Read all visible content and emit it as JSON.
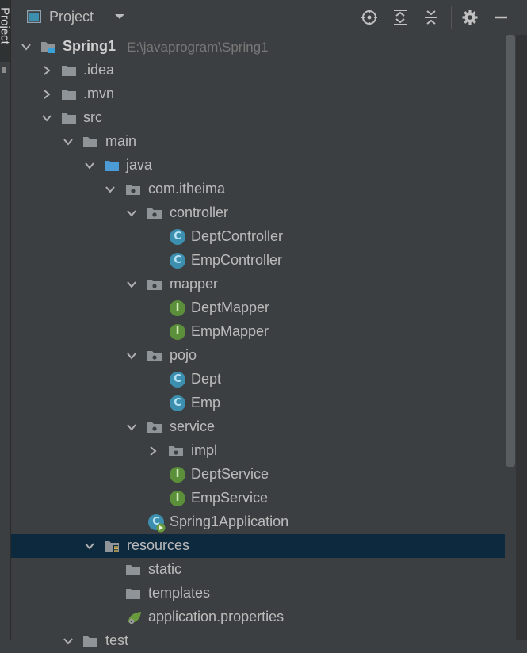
{
  "stripe": {
    "label": "Project"
  },
  "header": {
    "title": "Project",
    "icons": [
      "locate-icon",
      "expand-all-icon",
      "collapse-all-icon",
      "gear-icon",
      "minimize-icon"
    ]
  },
  "tree": {
    "root": {
      "label": "Spring1",
      "path": "E:\\javaprogram\\Spring1"
    },
    "items": [
      {
        "label": ".idea"
      },
      {
        "label": ".mvn"
      },
      {
        "label": "src"
      },
      {
        "label": "main"
      },
      {
        "label": "java"
      },
      {
        "label": "com.itheima"
      },
      {
        "label": "controller"
      },
      {
        "label": "DeptController",
        "badge": "C"
      },
      {
        "label": "EmpController",
        "badge": "C"
      },
      {
        "label": "mapper"
      },
      {
        "label": "DeptMapper",
        "badge": "I"
      },
      {
        "label": "EmpMapper",
        "badge": "I"
      },
      {
        "label": "pojo"
      },
      {
        "label": "Dept",
        "badge": "C"
      },
      {
        "label": "Emp",
        "badge": "C"
      },
      {
        "label": "service"
      },
      {
        "label": "impl"
      },
      {
        "label": "DeptService",
        "badge": "I"
      },
      {
        "label": "EmpService",
        "badge": "I"
      },
      {
        "label": "Spring1Application",
        "badge": "C"
      },
      {
        "label": "resources"
      },
      {
        "label": "static"
      },
      {
        "label": "templates"
      },
      {
        "label": "application.properties"
      },
      {
        "label": "test"
      }
    ]
  },
  "colors": {
    "background": "#3c3f41",
    "selection": "#0d293e",
    "text": "#bbbbbb",
    "class_icon": "#3d8fb0",
    "interface_icon": "#5b8f3a",
    "source_folder": "#4a9bd6"
  }
}
